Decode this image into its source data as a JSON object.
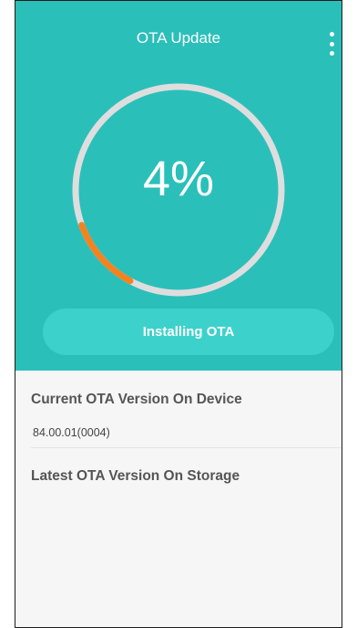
{
  "app": {
    "title": "OTA Update",
    "menu_icon": "more-vertical-icon"
  },
  "progress": {
    "percent": 4,
    "percent_label": "4%",
    "track_color": "#dedede",
    "fill_color": "#f5821f"
  },
  "action": {
    "button_label": "Installing OTA"
  },
  "current_version": {
    "label": "Current OTA Version On Device",
    "value": "84.00.01(0004)"
  },
  "latest_version": {
    "label": "Latest OTA Version On Storage"
  },
  "colors": {
    "header": "#2bbfba",
    "button": "#3dd1cc",
    "background": "#f6f6f6"
  }
}
